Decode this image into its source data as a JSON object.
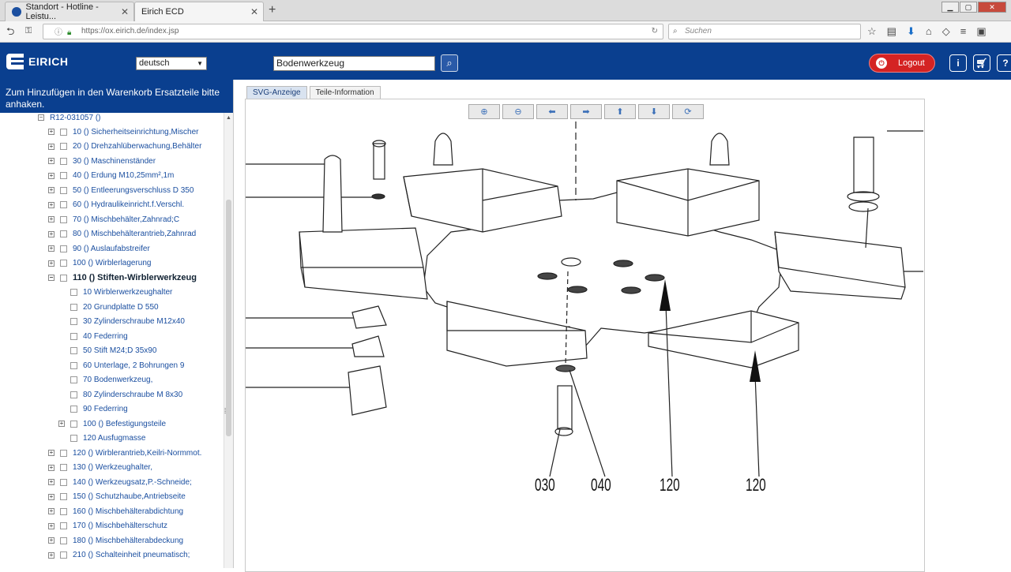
{
  "browser": {
    "tabs": [
      {
        "title": "Standort - Hotline - Leistu...",
        "active": false
      },
      {
        "title": "Eirich ECD",
        "active": true
      }
    ],
    "url": "https://ox.eirich.de/index.jsp",
    "search_placeholder": "Suchen"
  },
  "header": {
    "logo_text": "EIRICH",
    "language": "deutsch",
    "search_value": "Bodenwerkzeug",
    "logout_label": "Logout",
    "icons": [
      "info-icon",
      "cart-icon",
      "help-icon"
    ]
  },
  "sidebar": {
    "banner": "Zum Hinzufügen in den Warenkorb Ersatzteile bitte anhaken.",
    "root": "R12-031057 ()",
    "items": [
      {
        "label": "10 () Sicherheitseinrichtung,Mischer",
        "level": 1,
        "expand": "+"
      },
      {
        "label": "20 () Drehzahlüberwachung,Behälter",
        "level": 1,
        "expand": "+"
      },
      {
        "label": "30 () Maschinenständer",
        "level": 1,
        "expand": "+"
      },
      {
        "label": "40 () Erdung M10,25mm²,1m",
        "level": 1,
        "expand": "+"
      },
      {
        "label": "50 () Entleerungsverschluss D 350",
        "level": 1,
        "expand": "+"
      },
      {
        "label": "60 () Hydraulikeinricht.f.Verschl.",
        "level": 1,
        "expand": "+"
      },
      {
        "label": "70 () Mischbehälter,Zahnrad;C",
        "level": 1,
        "expand": "+"
      },
      {
        "label": "80 () Mischbehälterantrieb,Zahnrad",
        "level": 1,
        "expand": "+"
      },
      {
        "label": "90 () Auslaufabstreifer",
        "level": 1,
        "expand": "+"
      },
      {
        "label": "100 () Wirblerlagerung",
        "level": 1,
        "expand": "+"
      },
      {
        "label": "110 () Stiften-Wirblerwerkzeug",
        "level": 1,
        "expand": "−",
        "bold": true
      },
      {
        "label": "10 Wirblerwerkzeughalter",
        "level": 2,
        "expand": ""
      },
      {
        "label": "20 Grundplatte D 550",
        "level": 2,
        "expand": ""
      },
      {
        "label": "30 Zylinderschraube M12x40",
        "level": 2,
        "expand": ""
      },
      {
        "label": "40 Federring",
        "level": 2,
        "expand": ""
      },
      {
        "label": "50 Stift M24;D 35x90",
        "level": 2,
        "expand": ""
      },
      {
        "label": "60 Unterlage, 2 Bohrungen 9",
        "level": 2,
        "expand": ""
      },
      {
        "label": "70 Bodenwerkzeug,",
        "level": 2,
        "expand": ""
      },
      {
        "label": "80 Zylinderschraube M 8x30",
        "level": 2,
        "expand": ""
      },
      {
        "label": "90 Federring",
        "level": 2,
        "expand": ""
      },
      {
        "label": "100 () Befestigungsteile",
        "level": 2,
        "expand": "+"
      },
      {
        "label": "120 Ausfugmasse",
        "level": 2,
        "expand": ""
      },
      {
        "label": "120 () Wirblerantrieb,Keilri-Normmot.",
        "level": 1,
        "expand": "+"
      },
      {
        "label": "130 () Werkzeughalter,",
        "level": 1,
        "expand": "+"
      },
      {
        "label": "140 () Werkzeugsatz,P.-Schneide;",
        "level": 1,
        "expand": "+"
      },
      {
        "label": "150 () Schutzhaube,Antriebseite",
        "level": 1,
        "expand": "+"
      },
      {
        "label": "160 () Mischbehälterabdichtung",
        "level": 1,
        "expand": "+"
      },
      {
        "label": "170 () Mischbehälterschutz",
        "level": 1,
        "expand": "+"
      },
      {
        "label": "180 () Mischbehälterabdeckung",
        "level": 1,
        "expand": "+"
      },
      {
        "label": "210 () Schalteinheit pneumatisch;",
        "level": 1,
        "expand": "+"
      }
    ]
  },
  "content": {
    "tabs": [
      "SVG-Anzeige",
      "Teile-Information"
    ],
    "toolbar": [
      "zoom-in-icon",
      "zoom-out-icon",
      "arrow-left-icon",
      "arrow-right-icon",
      "arrow-up-icon",
      "arrow-down-icon",
      "refresh-icon"
    ],
    "callouts": [
      "030",
      "040",
      "120",
      "120"
    ]
  },
  "colors": {
    "header_blue": "#0a3f8f",
    "logout_red": "#d42323"
  }
}
